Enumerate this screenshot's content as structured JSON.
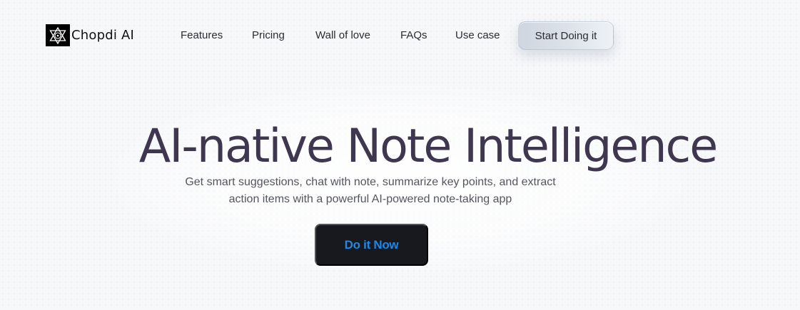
{
  "brand": {
    "name": "Chopdi AI",
    "logo_icon": "hexagram-star-icon"
  },
  "nav": {
    "links": [
      {
        "label": "Features"
      },
      {
        "label": "Pricing"
      },
      {
        "label": "Wall of love"
      },
      {
        "label": "FAQs"
      },
      {
        "label": "Use case"
      }
    ],
    "cta_label": "Start Doing it"
  },
  "hero": {
    "title": "AI-native Note Intelligence",
    "subtitle_line1": "Get smart suggestions, chat with note, summarize key points, and extract",
    "subtitle_line2": "action items with a powerful AI-powered note-taking app",
    "cta_label": "Do it Now"
  },
  "colors": {
    "background": "#f7f8fa",
    "title": "#3f3650",
    "cta_main_bg": "#18181f",
    "cta_main_text": "#1e88e5"
  }
}
